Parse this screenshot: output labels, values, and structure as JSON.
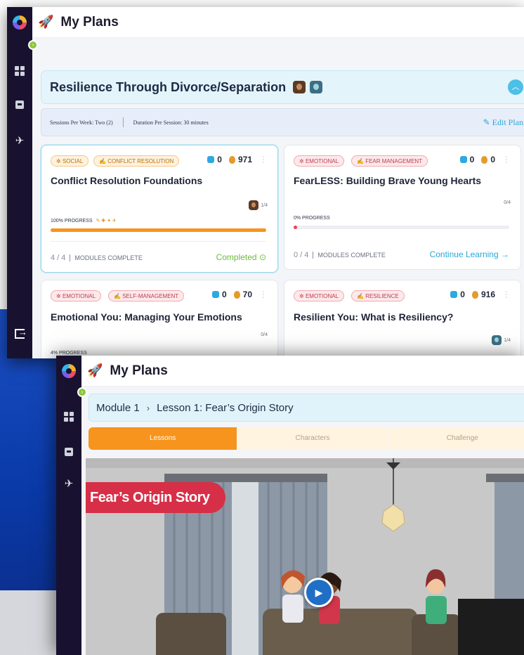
{
  "window1": {
    "title": "My Plans",
    "plan": {
      "title": "Resilience Through Divorce/Separation",
      "sessions": "Sessions Per Week: Two (2)",
      "duration": "Duration Per Session: 30 minutes",
      "edit_label": "Edit Plan"
    },
    "cards": [
      {
        "tags": [
          "SOCIAL",
          "CONFLICT RESOLUTION"
        ],
        "gems": "0",
        "coins": "971",
        "title": "Conflict Resolution Foundations",
        "count": "1/4",
        "progress_label": "100% PROGRESS",
        "progress": 100,
        "modules_count": "4 / 4",
        "modules_label": "MODULES COMPLETE",
        "status": "Completed ⊙"
      },
      {
        "tags": [
          "EMOTIONAL",
          "FEAR MANAGEMENT"
        ],
        "gems": "0",
        "coins": "0",
        "title": "FearLESS: Building Brave Young Hearts",
        "count": "0/4",
        "progress_label": "0% PROGRESS",
        "progress": 0,
        "modules_count": "0 / 4",
        "modules_label": "MODULES COMPLETE",
        "status": "Continue Learning →"
      },
      {
        "tags": [
          "EMOTIONAL",
          "SELF-MANAGEMENT"
        ],
        "gems": "0",
        "coins": "70",
        "title": "Emotional You: Managing Your Emotions",
        "count": "0/4",
        "progress_label": "4% PROGRESS",
        "progress": 4
      },
      {
        "tags": [
          "EMOTIONAL",
          "RESILIENCE"
        ],
        "gems": "0",
        "coins": "916",
        "title": "Resilient You: What is Resiliency?",
        "count": "1/4"
      }
    ]
  },
  "window2": {
    "title": "My Plans",
    "breadcrumb": {
      "module": "Module 1",
      "separator": "›",
      "lesson": "Lesson 1: Fear’s Origin Story"
    },
    "tabs": [
      "Lessons",
      "Characters",
      "Challenge"
    ],
    "video_title": "Fear’s Origin Story"
  },
  "colors": {
    "sidebar": "#181230",
    "accent_orange": "#f7941d",
    "accent_blue": "#2aa7d6",
    "complete_green": "#6cbc3c",
    "progress_red": "#ef3e52"
  },
  "icons": [
    "app-logo-icon",
    "grid-icon",
    "box-icon",
    "rocket-icon",
    "logout-icon",
    "chevron-up-icon",
    "pencil-icon",
    "gem-icon",
    "coin-icon",
    "more-icon",
    "play-icon"
  ]
}
